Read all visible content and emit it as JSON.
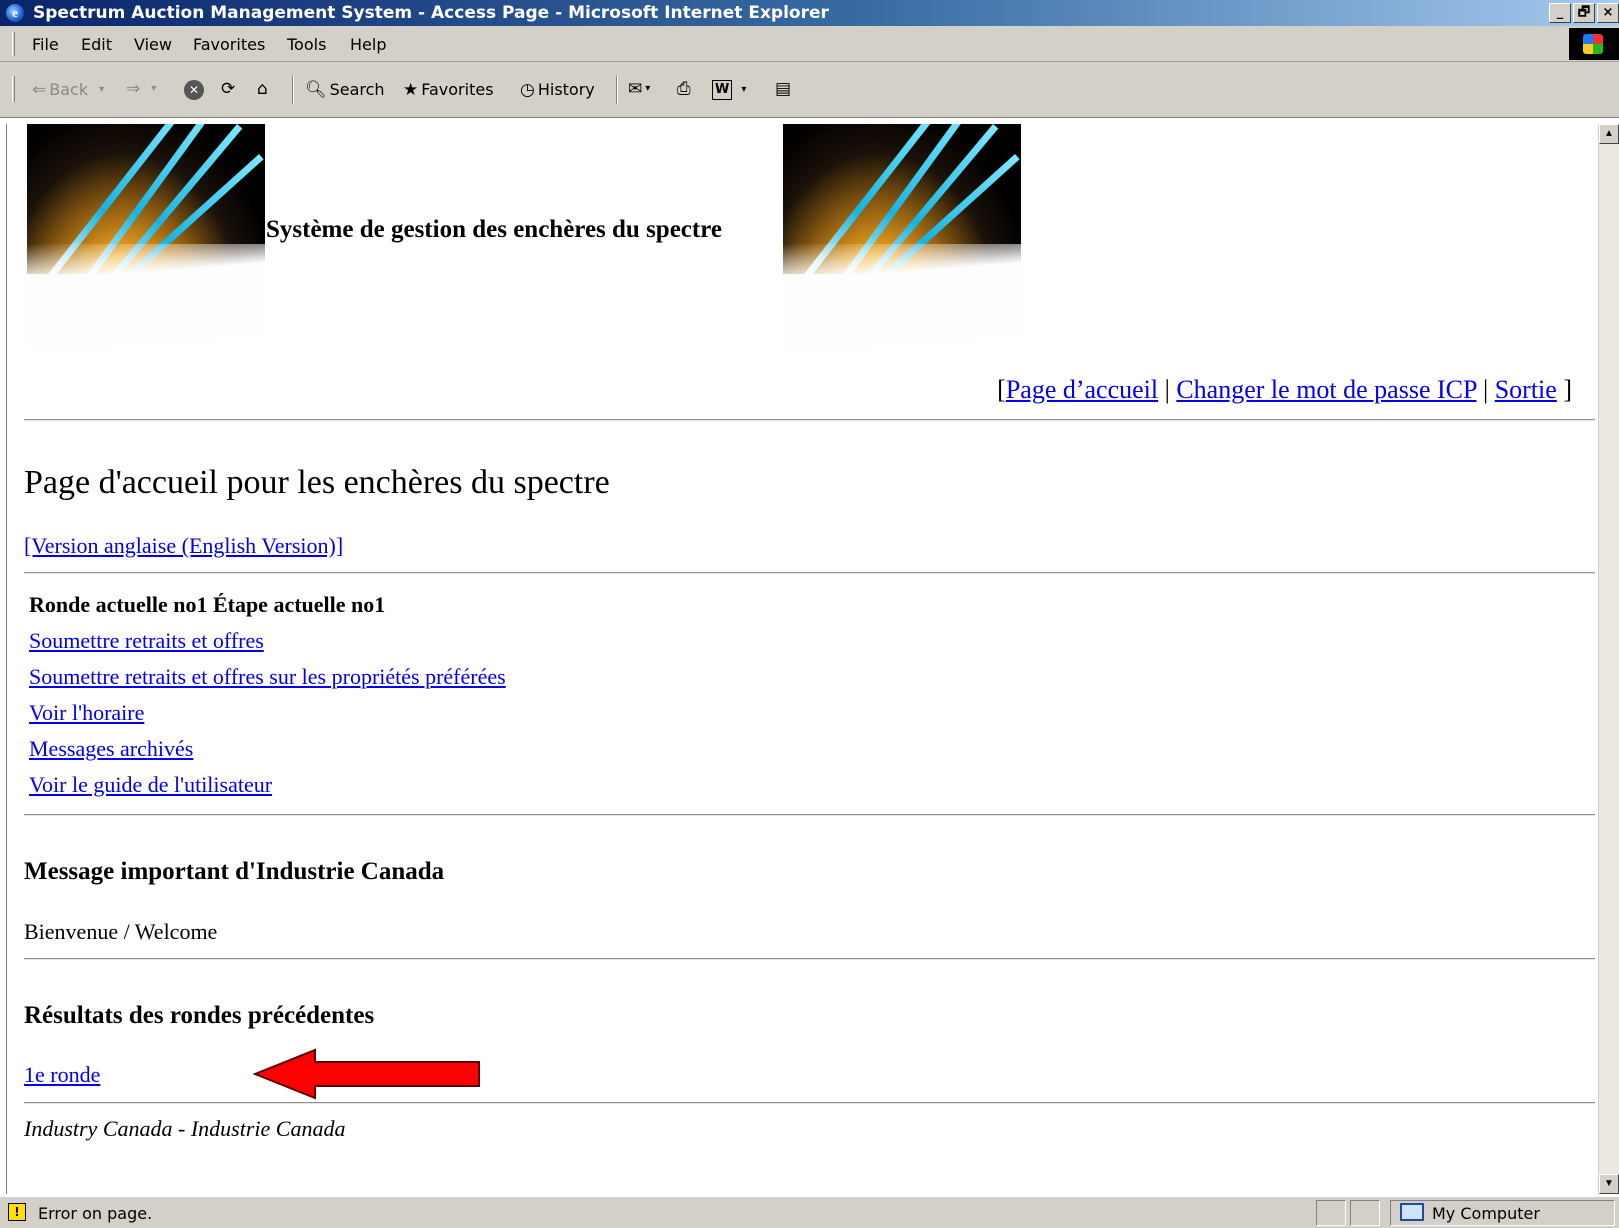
{
  "window": {
    "title": "Spectrum Auction Management System - Access Page - Microsoft Internet Explorer",
    "buttons": {
      "minimize": "_",
      "maximize": "🗗",
      "close": "×"
    }
  },
  "menu": [
    "File",
    "Edit",
    "View",
    "Favorites",
    "Tools",
    "Help"
  ],
  "toolbar": {
    "back": "Back",
    "search": "Search",
    "favorites": "Favorites",
    "history": "History"
  },
  "banner": {
    "system_title": "Système de gestion des enchères du spectre"
  },
  "top_links": {
    "open": "[",
    "home": "Page d’accueil",
    "sep1": " | ",
    "change_password": "Changer le mot de passe ICP",
    "sep2": " | ",
    "exit": "Sortie",
    "close": " ]"
  },
  "page": {
    "heading": "Page d'accueil pour les enchères du spectre",
    "english_link": "[Version anglaise (English Version)]",
    "round_status": "Ronde actuelle no1 Étape actuelle no1",
    "nav_links": [
      "Soumettre retraits et offres",
      "Soumettre retraits et offres sur les propriétés préférées",
      "Voir l'horaire",
      "Messages archivés",
      "Voir le guide de l'utilisateur"
    ],
    "message_heading": "Message important d'Industrie Canada",
    "message_body": "Bienvenue / Welcome",
    "results_heading": "Résultats des rondes précédentes",
    "round_link": "1e ronde",
    "footer": "Industry Canada - Industrie Canada"
  },
  "status_bar": {
    "text": "Error on page.",
    "zone": "My Computer"
  },
  "colors": {
    "link": "#0000ee",
    "chrome": "#d4d0c8",
    "titlebar": "#0a246a",
    "arrow": "#ff0000"
  }
}
